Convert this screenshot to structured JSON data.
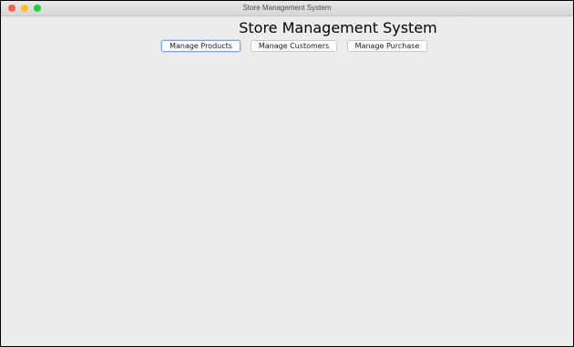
{
  "window": {
    "title": "Store Management System",
    "controls": {
      "close_color": "#ff5f57",
      "minimize_color": "#febc2e",
      "zoom_color": "#28c840"
    }
  },
  "header": {
    "title": "Store Management System"
  },
  "nav": {
    "buttons": [
      {
        "label": "Manage Products",
        "icon": "none",
        "focused": true
      },
      {
        "label": "Manage Customers",
        "icon": "none",
        "focused": false
      },
      {
        "label": "Manage Purchase",
        "icon": "none",
        "focused": false
      }
    ]
  },
  "colors": {
    "background": "#ececec",
    "focus_ring": "#7aa7e0"
  }
}
